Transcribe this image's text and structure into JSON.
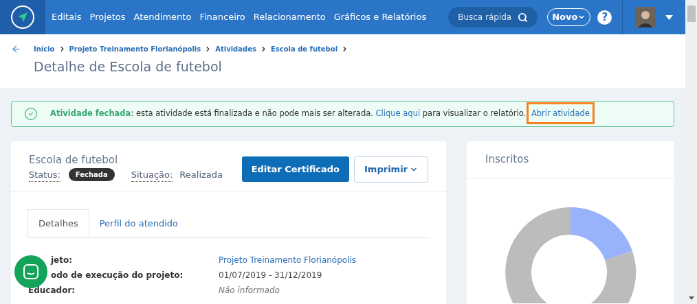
{
  "nav": {
    "items": [
      "Editais",
      "Projetos",
      "Atendimento",
      "Financeiro",
      "Relacionamento",
      "Gráficos e Relatórios"
    ],
    "search": {
      "placeholder": "Busca rápida"
    },
    "new_button": "Novo",
    "help": "?"
  },
  "breadcrumb": [
    "Início",
    "Projeto Treinamento Florianópolis",
    "Atividades",
    "Escola de futebol"
  ],
  "page_title": "Detalhe de Escola de futebol",
  "alert": {
    "parts": [
      {
        "kind": "strong",
        "text": "Atividade fechada"
      },
      {
        "kind": "text",
        "text": ": esta atividade está finalizada e não pode mais ser alterada. "
      },
      {
        "kind": "link",
        "text": "Clique aqui",
        "highlighted": false
      },
      {
        "kind": "text",
        "text": " para visualizar o relatório. "
      },
      {
        "kind": "link",
        "text": "Abrir atividade",
        "highlighted": true
      }
    ]
  },
  "activity": {
    "name": "Escola de futebol",
    "status_label": "Status:",
    "status": "Fechada",
    "situation_label": "Situação:",
    "situation": "Realizada",
    "buttons": [
      {
        "kind": "primary",
        "label": "Editar Certificado"
      },
      {
        "kind": "dropdown",
        "label": "Imprimir"
      }
    ]
  },
  "tabs": [
    {
      "label": "Detalhes",
      "selected": true
    },
    {
      "label": "Perfil do atendido",
      "selected": false
    }
  ],
  "details": [
    {
      "label": "jeto:",
      "value": "Projeto Treinamento Florianópolis",
      "kind": "link"
    },
    {
      "label": "odo de execução do projeto:",
      "value": "01/07/2019 - 31/12/2019",
      "kind": "text"
    },
    {
      "label": "Educador:",
      "value": "Não informado",
      "kind": "empty"
    }
  ],
  "side_card": {
    "title": "Inscritos"
  }
}
